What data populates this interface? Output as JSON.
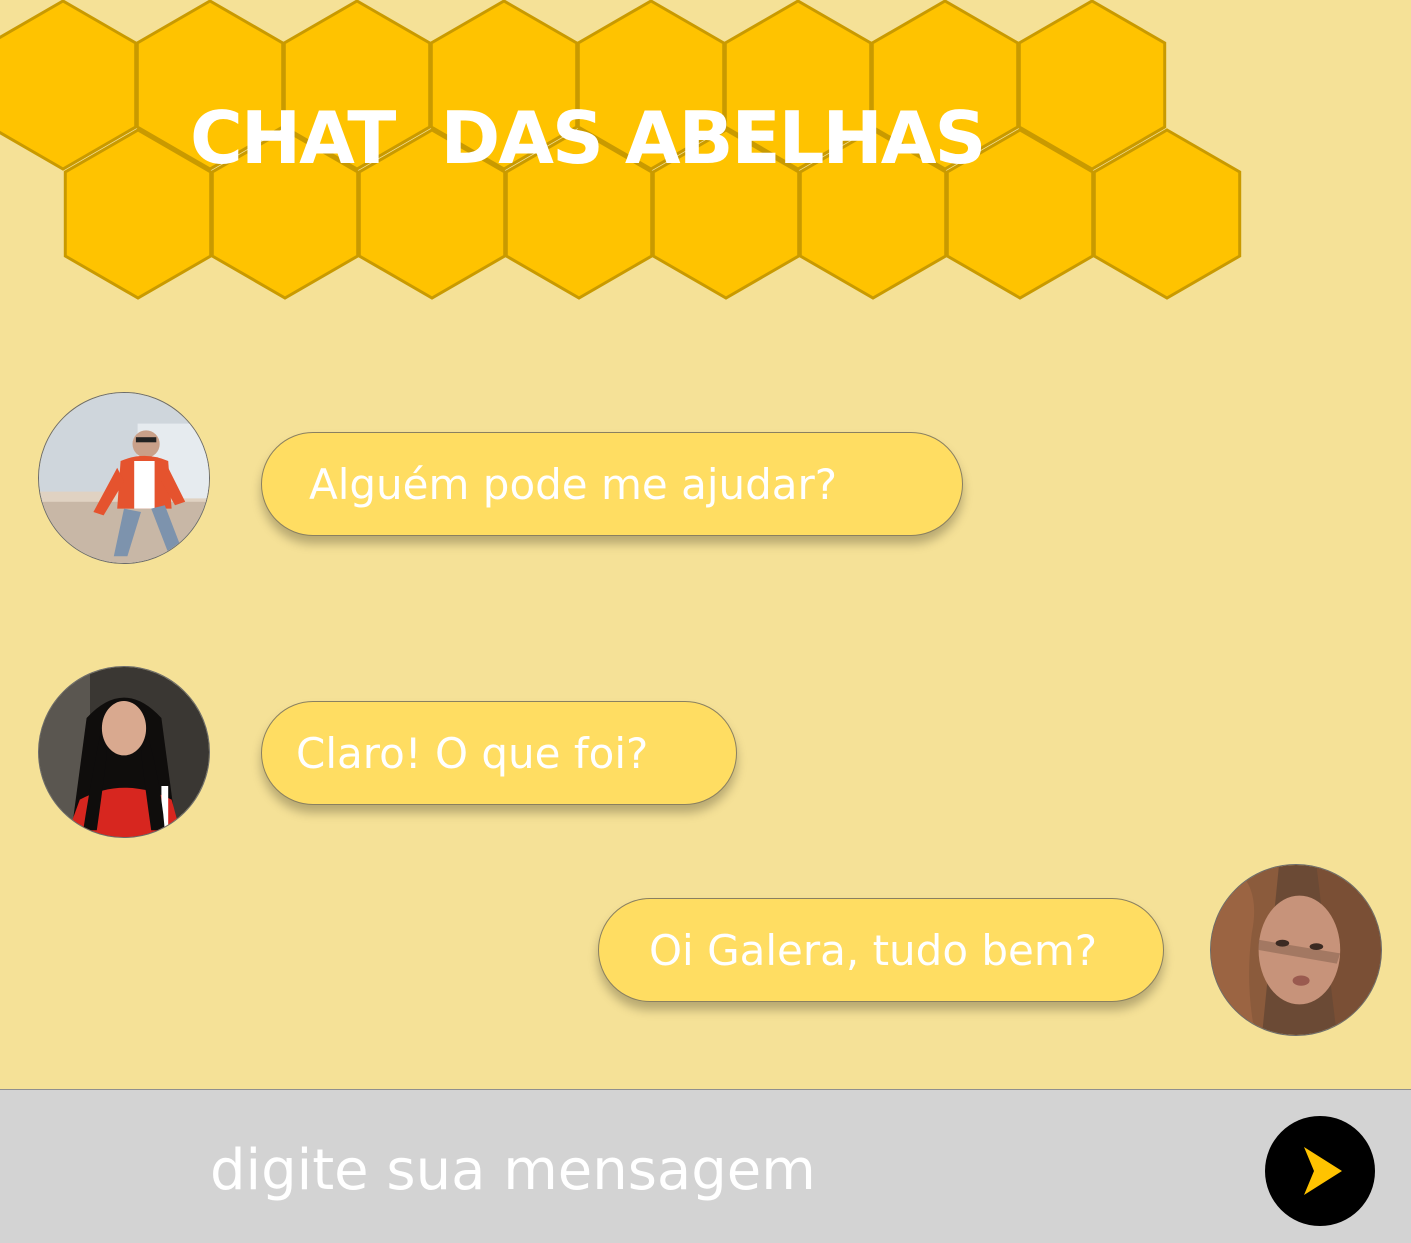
{
  "header": {
    "title": "CHAT  DAS ABELHAS",
    "decoration": "honeycomb-hexagons"
  },
  "colors": {
    "background": "#f5e197",
    "hexagon": "#ffc300",
    "hexagon_border": "#c99a00",
    "bubble": "#ffdd62",
    "input_bar": "#d3d3d3",
    "send_button": "#000000",
    "send_arrow": "#ffc300"
  },
  "messages": [
    {
      "text": "Alguém pode me ajudar?",
      "side": "left",
      "avatar": "man-orange-jacket-avatar"
    },
    {
      "text": "Claro! O que foi?",
      "side": "left",
      "avatar": "woman-dark-hair-avatar"
    },
    {
      "text": "Oi Galera, tudo bem?",
      "side": "right",
      "avatar": "woman-red-hair-avatar"
    }
  ],
  "composer": {
    "placeholder": "digite sua mensagem",
    "send_icon": "send-arrow-icon"
  }
}
